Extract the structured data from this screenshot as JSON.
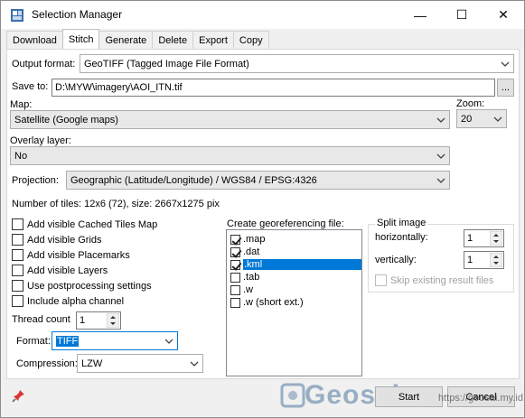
{
  "window": {
    "title": "Selection Manager",
    "controls": {
      "minimize": "—",
      "maximize": "☐",
      "close": "✕"
    }
  },
  "tabs": [
    "Download",
    "Stitch",
    "Generate",
    "Delete",
    "Export",
    "Copy"
  ],
  "active_tab": "Stitch",
  "output_format": {
    "label": "Output format:",
    "value": "GeoTIFF (Tagged Image File Format)"
  },
  "save_to": {
    "label": "Save to:",
    "value": "D:\\MYW\\imagery\\AOI_ITN.tif",
    "browse_label": "..."
  },
  "map": {
    "label": "Map:",
    "value": "Satellite (Google maps)"
  },
  "zoom": {
    "label": "Zoom:",
    "value": "20"
  },
  "overlay": {
    "label": "Overlay layer:",
    "value": "No"
  },
  "projection": {
    "label": "Projection:",
    "value": "Geographic (Latitude/Longitude) / WGS84 / EPSG:4326"
  },
  "tiles_info": "Number of tiles: 12x6 (72), size: 2667x1275 pix",
  "options": [
    {
      "label": "Add visible Cached Tiles Map",
      "checked": false
    },
    {
      "label": "Add visible Grids",
      "checked": false
    },
    {
      "label": "Add visible Placemarks",
      "checked": false
    },
    {
      "label": "Add visible Layers",
      "checked": false
    },
    {
      "label": "Use postprocessing settings",
      "checked": false
    },
    {
      "label": "Include alpha channel",
      "checked": false
    }
  ],
  "thread_count": {
    "label": "Thread count",
    "value": "1"
  },
  "format": {
    "label": "Format:",
    "value": "TIFF"
  },
  "compression": {
    "label": "Compression:",
    "value": "LZW"
  },
  "georef": {
    "label": "Create georeferencing file:",
    "items": [
      {
        "label": ".map",
        "checked": true
      },
      {
        "label": ".dat",
        "checked": true
      },
      {
        "label": ".kml",
        "checked": true,
        "selected": true
      },
      {
        "label": ".tab",
        "checked": false
      },
      {
        "label": ".w",
        "checked": false
      },
      {
        "label": ".w (short ext.)",
        "checked": false
      }
    ]
  },
  "split": {
    "title": "Split image",
    "horizontally_label": "horizontally:",
    "horizontally_value": "1",
    "vertically_label": "vertically:",
    "vertically_value": "1",
    "skip_label": "Skip existing result files"
  },
  "footer": {
    "start_label": "Start",
    "cancel_label": "Cancel"
  },
  "watermark": {
    "brand": "Geosai",
    "url": "https://geosai.my.id"
  }
}
